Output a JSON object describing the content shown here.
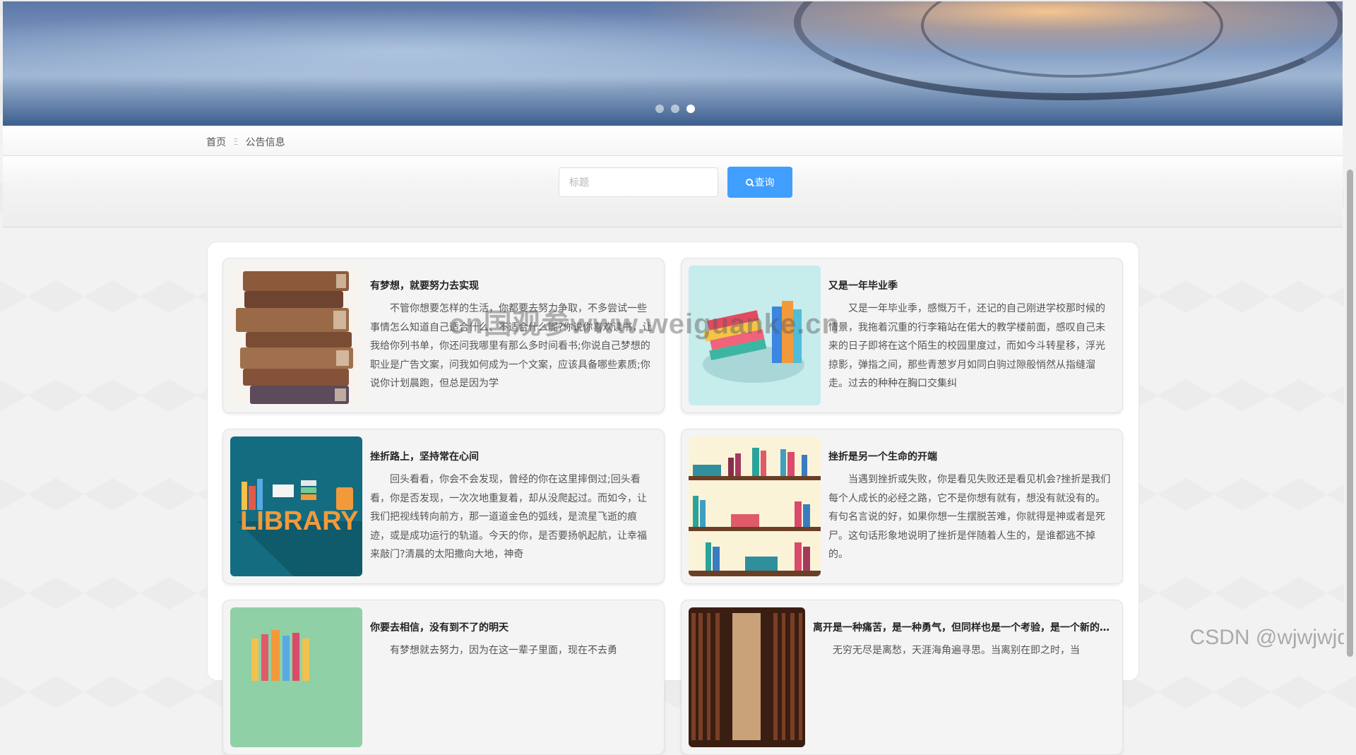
{
  "breadcrumb": {
    "home": "首页",
    "separator": "Ξ",
    "current": "公告信息"
  },
  "carousel": {
    "total": 3,
    "active_index": 3
  },
  "search": {
    "placeholder": "标题",
    "button_label": "查询"
  },
  "cards": [
    {
      "title": "有梦想，就要努力去实现",
      "text": "不管你想要怎样的生活，你都要去努力争取，不多尝试一些事情怎么知道自己适合什么、不适合什么呢?你说你喜欢读书，让我给你列书单，你还问我哪里有那么多时间看书;你说自己梦想的职业是广告文案，问我如何成为一个文案，应该具备哪些素质;你说你计划晨跑，但总是因为学",
      "thumb": "stacked-old-books"
    },
    {
      "title": "又是一年毕业季",
      "text": "又是一年毕业季，感慨万千，还记的自己刚进学校那时候的情景，我拖着沉重的行李箱站在偌大的教学楼前面，感叹自己未来的日子即将在这个陌生的校园里度过，而如今斗转星移，浮光掠影，弹指之间，那些青葱岁月如同白驹过隙般悄然从指缝溜走。过去的种种在胸口交集纠",
      "thumb": "colorful-books-illustration"
    },
    {
      "title": "挫折路上，坚持常在心间",
      "text": "回头看看，你会不会发现，曾经的你在这里摔倒过;回头看看，你是否发现，一次次地重复着，却从没爬起过。而如今，让我们把视线转向前方，那一道道金色的弧线，是流星飞逝的痕迹，或是成功运行的轨道。今天的你，是否要扬帆起航，让幸福来敲门?清晨的太阳撒向大地，神奇",
      "thumb": "library-illustration"
    },
    {
      "title": "挫折是另一个生命的开端",
      "text": "当遇到挫折或失败，你是看见失败还是看见机会?挫折是我们每个人成长的必经之路，它不是你想有就有，想没有就没有的。有句名言说的好，如果你想一生摆脱苦难，你就得是神或者是死尸。这句话形象地说明了挫折是伴随着人生的，是谁都逃不掉的。",
      "thumb": "bookshelf-illustration"
    },
    {
      "title": "你要去相信，没有到不了的明天",
      "text": "有梦想就去努力，因为在这一辈子里面，现在不去勇",
      "thumb": "green-books-illustration"
    },
    {
      "title": "离开是一种痛苦，是一种勇气，但同样也是一个考验，是一个新的开端",
      "text": "无穷无尽是离愁，天涯海角遍寻思。当离别在即之时，当",
      "thumb": "library-shelves-photo"
    }
  ],
  "watermark": "cn国观参www.weiguanke.cn",
  "csdn_watermark": "CSDN @wjwjwjd"
}
